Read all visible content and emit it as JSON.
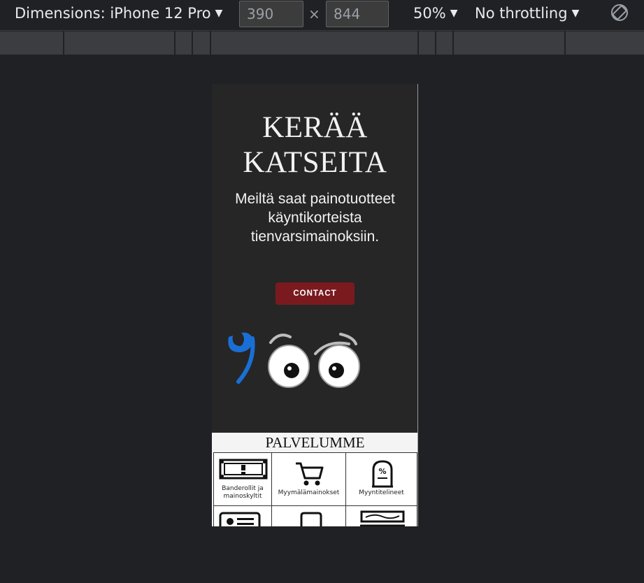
{
  "toolbar": {
    "dimensions_label": "Dimensions: iPhone 12 Pro",
    "width_value": "390",
    "height_value": "844",
    "times_symbol": "×",
    "zoom_label": "50%",
    "throttling_label": "No throttling",
    "caret": "▼"
  },
  "page": {
    "hero": {
      "title_line1": "KERÄÄ",
      "title_line2": "KATSEITA",
      "subtitle": "Meiltä saat painotuotteet käyntikorteista tienvarsimainoksiin.",
      "contact_label": "CONTACT"
    },
    "services": {
      "title": "PALVELUMME",
      "items": [
        {
          "label": "Banderollit ja mainoskyltit",
          "icon": "banner-icon"
        },
        {
          "label": "Myymälämainokset",
          "icon": "shopping-cart-icon"
        },
        {
          "label": "Myyntitelineet",
          "icon": "sales-stand-icon"
        },
        {
          "label": "",
          "icon": "business-card-icon"
        },
        {
          "label": "",
          "icon": "brochure-icon"
        },
        {
          "label": "",
          "icon": "billboard-icon"
        }
      ]
    }
  },
  "colors": {
    "devtools_bg": "#202124",
    "hero_bg": "#262626",
    "contact_button": "#7a1a1f",
    "logo_blue": "#1a6fd6"
  }
}
